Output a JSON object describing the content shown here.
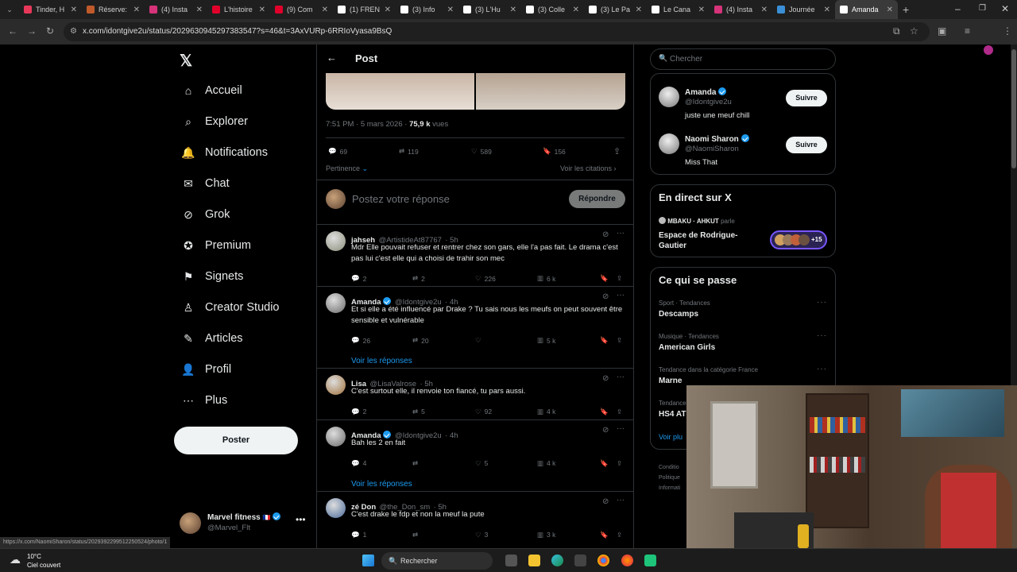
{
  "browser": {
    "tabs": [
      {
        "label": "Tinder, H",
        "color": "#e8385a"
      },
      {
        "label": "Réserve:",
        "color": "#c05a2a"
      },
      {
        "label": "(4) Insta",
        "color": "#d6337a"
      },
      {
        "label": "L'histoire",
        "color": "#e0002a"
      },
      {
        "label": "(9) Com",
        "color": "#e0002a"
      },
      {
        "label": "(1) FREN",
        "color": "#ffffff"
      },
      {
        "label": "(3) Info",
        "color": "#ffffff"
      },
      {
        "label": "(3) L'Hu",
        "color": "#ffffff"
      },
      {
        "label": "(3) Colle",
        "color": "#ffffff"
      },
      {
        "label": "(3) Le Pa",
        "color": "#ffffff"
      },
      {
        "label": "Le Cana",
        "color": "#ffffff"
      },
      {
        "label": "(4) Insta",
        "color": "#d6337a"
      },
      {
        "label": "Journée",
        "color": "#3b8fd6"
      },
      {
        "label": "Amanda",
        "color": "#ffffff"
      }
    ],
    "url": "x.com/idontgive2u/status/2029630945297383547?s=46&t=3AxVURp-6RRIoVyasa9BsQ",
    "status_url": "https://x.com/NaomiSharon/status/2029392299512250524/photo/1"
  },
  "sidebar": {
    "items": [
      {
        "label": "Accueil",
        "icon": "home-icon"
      },
      {
        "label": "Explorer",
        "icon": "search-icon"
      },
      {
        "label": "Notifications",
        "icon": "bell-icon"
      },
      {
        "label": "Chat",
        "icon": "mail-icon"
      },
      {
        "label": "Grok",
        "icon": "grok-icon"
      },
      {
        "label": "Premium",
        "icon": "premium-icon"
      },
      {
        "label": "Signets",
        "icon": "bookmark-icon"
      },
      {
        "label": "Creator Studio",
        "icon": "creator-icon"
      },
      {
        "label": "Articles",
        "icon": "articles-icon"
      },
      {
        "label": "Profil",
        "icon": "user-icon"
      },
      {
        "label": "Plus",
        "icon": "more-icon"
      }
    ],
    "post_button": "Poster",
    "account": {
      "name": "Marvel fitness",
      "handle": "@Marvel_Flt"
    }
  },
  "post": {
    "header": "Post",
    "time": "7:51 PM · 5 mars 2026 · ",
    "views": "75,9 k",
    "views_label": "vues",
    "stats": {
      "replies": "69",
      "reposts": "119",
      "likes": "589",
      "bookmarks": "156"
    },
    "sort": "Pertinence",
    "quotes": "Voir les citations",
    "reply_placeholder": "Postez votre réponse",
    "reply_button": "Répondre"
  },
  "replies": [
    {
      "name": "jahseh",
      "handle": "@ArtistideAt87767",
      "time": "· 5h",
      "verified": false,
      "text": "Mdr  Elle pouvait refuser et rentrer chez son gars, elle l'a pas fait. Le drama c'est pas lui c'est elle qui a choisi de trahir son mec",
      "replies": "2",
      "reposts": "2",
      "likes": "226",
      "views": "6 k",
      "avatar": "#8a8f7a"
    },
    {
      "name": "Amanda",
      "handle": "@Idontgive2u",
      "time": "· 4h",
      "verified": true,
      "text": "Et si elle a été influencé par Drake ? Tu sais nous les meufs on peut souvent être sensible et vulnérable",
      "replies": "26",
      "reposts": "20",
      "likes": "",
      "views": "5 k",
      "show_replies": "Voir les réponses",
      "avatar": "#6a6a6a"
    },
    {
      "name": "Lisa",
      "handle": "@LisaValrose",
      "time": "· 5h",
      "verified": false,
      "text": "C'est surtout elle, il renvoie ton fiancé, tu pars aussi.",
      "replies": "2",
      "reposts": "5",
      "likes": "92",
      "views": "4 k",
      "avatar": "#a0703a"
    },
    {
      "name": "Amanda",
      "handle": "@Idontgive2u",
      "time": "· 4h",
      "verified": true,
      "text": "Bah les 2 en fait",
      "replies": "4",
      "reposts": "",
      "likes": "5",
      "views": "4 k",
      "show_replies": "Voir les réponses",
      "avatar": "#6a6a6a"
    },
    {
      "name": "zé Don",
      "handle": "@the_Don_sm",
      "time": "· 5h",
      "verified": false,
      "text": "C'est drake le fdp et non la meuf la pute",
      "replies": "1",
      "reposts": "",
      "likes": "3",
      "views": "3 k",
      "avatar": "#4a6a9a"
    }
  ],
  "right": {
    "search_placeholder": "Chercher",
    "follows": [
      {
        "name": "Amanda",
        "handle": "@Idontgive2u",
        "bio": "juste une meuf chill",
        "button": "Suivre"
      },
      {
        "name": "Naomi Sharon",
        "handle": "@NaomiSharon",
        "bio": "Miss That",
        "button": "Suivre"
      }
    ],
    "live": {
      "title": "En direct sur X",
      "hosts": "MBAKU · AHKUT",
      "speaks": "parle",
      "space": "Espace de Rodrigue-Gautier",
      "count": "+15"
    },
    "trends_title": "Ce qui se passe",
    "trends": [
      {
        "cat": "Sport · Tendances",
        "title": "Descamps"
      },
      {
        "cat": "Musique · Tendances",
        "title": "American Girls"
      },
      {
        "cat": "Tendance dans la catégorie France",
        "title": "Marne"
      },
      {
        "cat": "Tendance",
        "title": "HS4 AT"
      }
    ],
    "show_more": "Voir plu",
    "footer": [
      "Conditio",
      "Politique",
      "Informati"
    ]
  },
  "taskbar": {
    "weather_temp": "10°C",
    "weather_desc": "Ciel couvert",
    "search": "Rechercher"
  }
}
